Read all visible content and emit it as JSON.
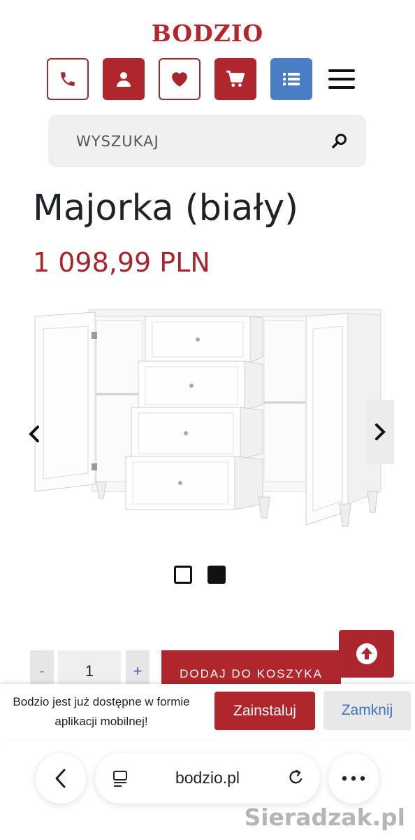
{
  "header": {
    "logo": "BODZIO",
    "nav_icons": [
      "phone-icon",
      "user-icon",
      "heart-icon",
      "cart-icon",
      "list-icon",
      "menu-icon"
    ],
    "colors": {
      "brand_red": "#b0262d",
      "nav_blue": "#4a7dc4"
    }
  },
  "search": {
    "placeholder": "WYSZUKAJ",
    "icon": "search-icon"
  },
  "product": {
    "title": "Majorka (biały)",
    "price": "1 098,99 PLN",
    "gallery": {
      "image_count": 2,
      "active_index": 2
    }
  },
  "cart": {
    "minus_label": "-",
    "quantity": "1",
    "plus_label": "+",
    "add_label": "DODAJ DO KOSZYKA"
  },
  "app_banner": {
    "line1": "Bodzio jest już dostępne w formie",
    "line2": "aplikacji mobilnej!",
    "install_label": "Zainstaluj",
    "close_label": "Zamknij"
  },
  "browser": {
    "url": "bodzio.pl"
  },
  "watermark": "Sieradzak.pl"
}
